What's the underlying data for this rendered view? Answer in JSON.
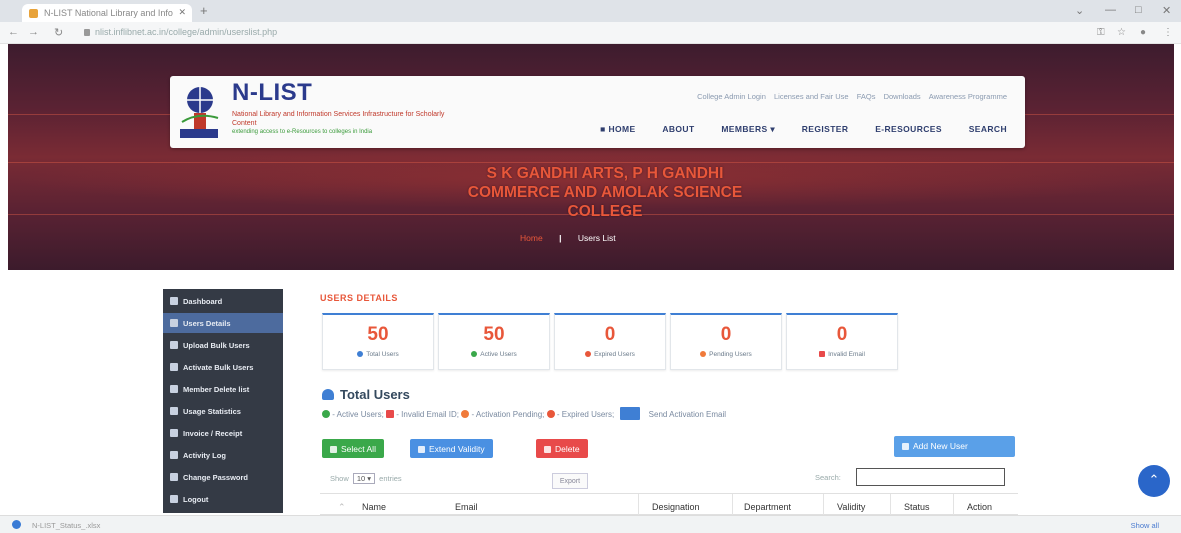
{
  "browser": {
    "tab_title": "N-LIST National Library and Info",
    "url": "nlist.inflibnet.ac.in/college/admin/userslist.php"
  },
  "site": {
    "logo_title": "N-LIST",
    "logo_subtitle_1": "National Library and Information Services Infrastructure for Scholarly Content",
    "logo_subtitle_2": "extending access to e-Resources to colleges in India",
    "top_links": [
      "College Admin Login",
      "Licenses and Fair Use",
      "FAQs",
      "Downloads",
      "Awareness Programme"
    ],
    "nav": [
      "HOME",
      "ABOUT",
      "MEMBERS ▾",
      "REGISTER",
      "E-RESOURCES",
      "SEARCH"
    ],
    "college_name": "S K GANDHI ARTS, P H GANDHI COMMERCE AND AMOLAK SCIENCE COLLEGE",
    "breadcrumb": {
      "home": "Home",
      "separator": "|",
      "current": "Users List"
    }
  },
  "sidebar": {
    "items": [
      {
        "label": "Dashboard",
        "icon": "dashboard-icon"
      },
      {
        "label": "Users Details",
        "icon": "users-icon",
        "active": true
      },
      {
        "label": "Upload Bulk Users",
        "icon": "upload-icon"
      },
      {
        "label": "Activate Bulk Users",
        "icon": "activate-icon"
      },
      {
        "label": "Member Delete list",
        "icon": "delete-list-icon"
      },
      {
        "label": "Usage Statistics",
        "icon": "chart-icon"
      },
      {
        "label": "Invoice / Receipt",
        "icon": "invoice-icon"
      },
      {
        "label": "Activity Log",
        "icon": "log-icon"
      },
      {
        "label": "Change Password",
        "icon": "key-icon"
      },
      {
        "label": "Logout",
        "icon": "logout-icon"
      }
    ]
  },
  "main": {
    "section_title": "USERS DETAILS",
    "stats": [
      {
        "value": "50",
        "label": "Total Users",
        "color": "#3f7fd4"
      },
      {
        "value": "50",
        "label": "Active Users",
        "color": "#3aa84a"
      },
      {
        "value": "0",
        "label": "Expired Users",
        "color": "#e8573a"
      },
      {
        "value": "0",
        "label": "Pending Users",
        "color": "#f07a3a"
      },
      {
        "value": "0",
        "label": "Invalid Email",
        "color": "#e84a4a"
      }
    ],
    "total_users_title": "Total Users",
    "legend": {
      "active": "- Active Users;",
      "invalid": "- Invalid Email ID;",
      "pending": "- Activation Pending;",
      "expired": "- Expired Users;",
      "send": "Send Activation Email"
    },
    "buttons": {
      "select_all": "Select All",
      "extend_validity": "Extend Validity",
      "delete": "Delete",
      "add_new_user": "Add New User"
    },
    "table": {
      "show_prefix": "Show",
      "show_value": "10 ▾",
      "show_suffix": "entries",
      "export": "Export",
      "search_label": "Search:",
      "columns": [
        "Name",
        "Email",
        "Designation",
        "Department",
        "Validity",
        "Status",
        "Action"
      ]
    }
  },
  "status_bar": {
    "download": "N-LIST_Status_.xlsx",
    "show_all": "Show all"
  },
  "colors": {
    "accent_blue": "#3f7fd4",
    "green": "#3aa84a",
    "red": "#e84a4a",
    "orange": "#e8573a",
    "sidebar_bg": "#343a45"
  }
}
